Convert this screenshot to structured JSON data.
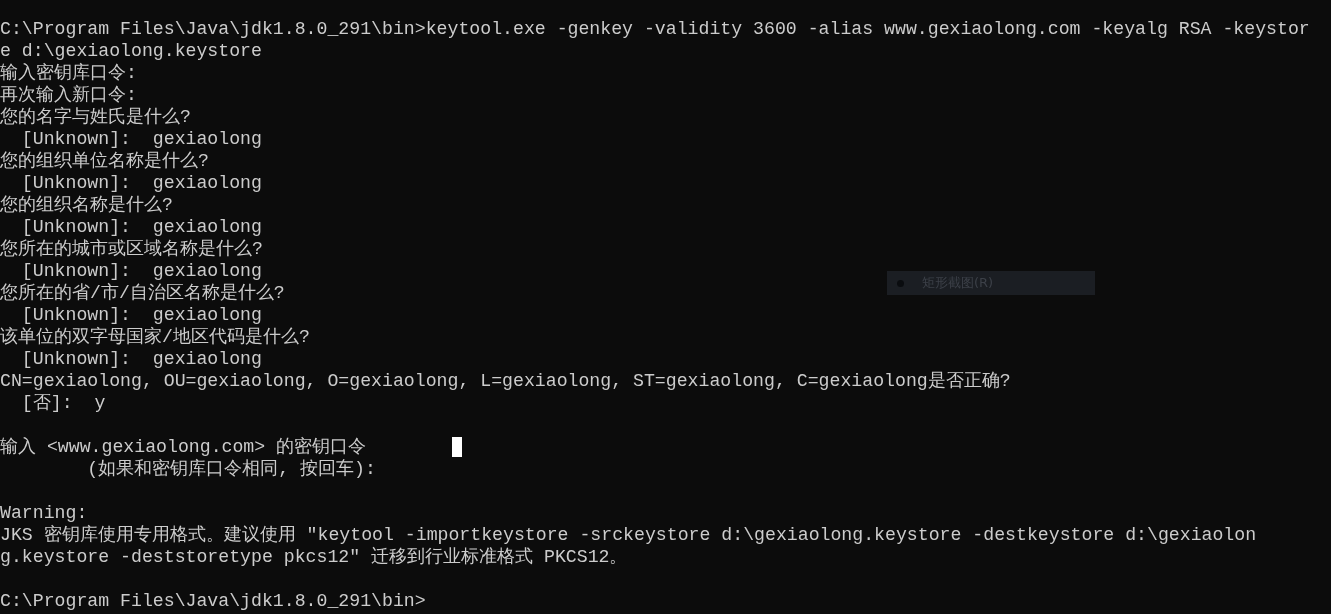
{
  "console": {
    "lines": [
      {
        "kind": "text",
        "text": "C:\\Program Files\\Java\\jdk1.8.0_291\\bin>keytool.exe -genkey -validity 3600 -alias www.gexiaolong.com -keyalg RSA -keystor"
      },
      {
        "kind": "text",
        "text": "e d:\\gexiaolong.keystore"
      },
      {
        "kind": "text",
        "text": "输入密钥库口令:"
      },
      {
        "kind": "text",
        "text": "再次输入新口令:"
      },
      {
        "kind": "text",
        "text": "您的名字与姓氏是什么?"
      },
      {
        "kind": "text",
        "text": "  [Unknown]:  gexiaolong"
      },
      {
        "kind": "text",
        "text": "您的组织单位名称是什么?"
      },
      {
        "kind": "text",
        "text": "  [Unknown]:  gexiaolong"
      },
      {
        "kind": "text",
        "text": "您的组织名称是什么?"
      },
      {
        "kind": "text",
        "text": "  [Unknown]:  gexiaolong"
      },
      {
        "kind": "text",
        "text": "您所在的城市或区域名称是什么?"
      },
      {
        "kind": "text",
        "text": "  [Unknown]:  gexiaolong"
      },
      {
        "kind": "text",
        "text": "您所在的省/市/自治区名称是什么?"
      },
      {
        "kind": "text",
        "text": "  [Unknown]:  gexiaolong"
      },
      {
        "kind": "text",
        "text": "该单位的双字母国家/地区代码是什么?"
      },
      {
        "kind": "text",
        "text": "  [Unknown]:  gexiaolong"
      },
      {
        "kind": "text",
        "text": "CN=gexiaolong, OU=gexiaolong, O=gexiaolong, L=gexiaolong, ST=gexiaolong, C=gexiaolong是否正确?"
      },
      {
        "kind": "text",
        "text": "  [否]:  y"
      },
      {
        "kind": "blank"
      },
      {
        "kind": "text",
        "text": "输入 <www.gexiaolong.com> 的密钥口令",
        "cursor": true
      },
      {
        "kind": "text",
        "text": "        (如果和密钥库口令相同, 按回车):"
      },
      {
        "kind": "blank"
      },
      {
        "kind": "text",
        "text": "Warning:"
      },
      {
        "kind": "text",
        "text": "JKS 密钥库使用专用格式。建议使用 \"keytool -importkeystore -srckeystore d:\\gexiaolong.keystore -destkeystore d:\\gexiaolon"
      },
      {
        "kind": "text",
        "text": "g.keystore -deststoretype pkcs12\" 迁移到行业标准格式 PKCS12。"
      },
      {
        "kind": "blank"
      },
      {
        "kind": "text",
        "text": "C:\\Program Files\\Java\\jdk1.8.0_291\\bin>"
      }
    ]
  },
  "tooltip": {
    "text": "矩形截图(R)"
  }
}
